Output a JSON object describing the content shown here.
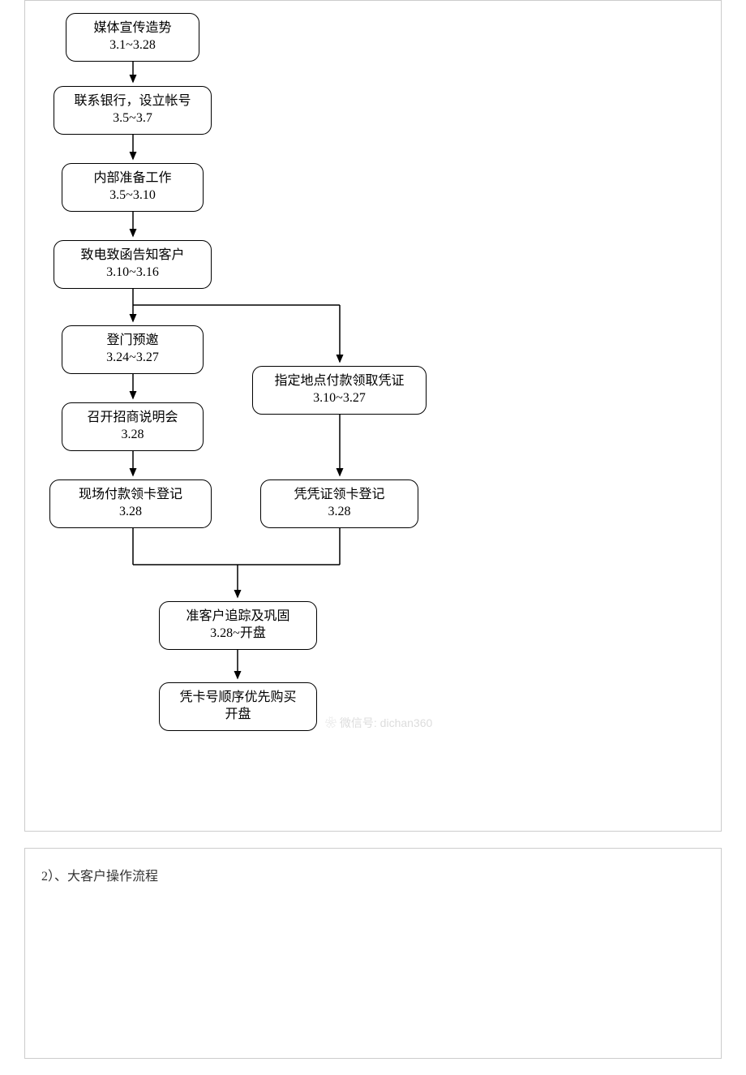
{
  "chart_data": {
    "type": "flowchart",
    "nodes": [
      {
        "id": "n1",
        "title": "媒体宣传造势",
        "date": "3.1~3.28"
      },
      {
        "id": "n2",
        "title": "联系银行，设立帐号",
        "date": "3.5~3.7"
      },
      {
        "id": "n3",
        "title": "内部准备工作",
        "date": "3.5~3.10"
      },
      {
        "id": "n4",
        "title": "致电致函告知客户",
        "date": "3.10~3.16"
      },
      {
        "id": "n5",
        "title": "登门预邀",
        "date": "3.24~3.27"
      },
      {
        "id": "n6",
        "title": "召开招商说明会",
        "date": "3.28"
      },
      {
        "id": "n7",
        "title": "现场付款领卡登记",
        "date": "3.28"
      },
      {
        "id": "n8",
        "title": "指定地点付款领取凭证",
        "date": "3.10~3.27"
      },
      {
        "id": "n9",
        "title": "凭凭证领卡登记",
        "date": "3.28"
      },
      {
        "id": "n10",
        "title": "准客户追踪及巩固",
        "date": "3.28~开盘"
      },
      {
        "id": "n11",
        "title": "凭卡号顺序优先购买",
        "date": "开盘"
      }
    ],
    "edges": [
      [
        "n1",
        "n2"
      ],
      [
        "n2",
        "n3"
      ],
      [
        "n3",
        "n4"
      ],
      [
        "n4",
        "n5"
      ],
      [
        "n4",
        "n8"
      ],
      [
        "n5",
        "n6"
      ],
      [
        "n6",
        "n7"
      ],
      [
        "n8",
        "n9"
      ],
      [
        "n7",
        "n10"
      ],
      [
        "n9",
        "n10"
      ],
      [
        "n10",
        "n11"
      ]
    ]
  },
  "watermark": "微信号: dichan360",
  "section2": "2）、大客户操作流程"
}
